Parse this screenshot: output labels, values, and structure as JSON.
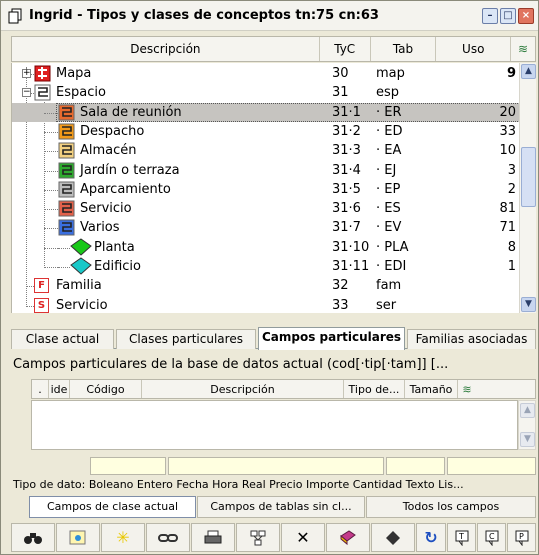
{
  "window": {
    "title": "Ingrid - Tipos y clases de conceptos tn:75 cn:63",
    "min": "–",
    "max": "□",
    "close": "×"
  },
  "columns": {
    "descripcion": "Descripción",
    "tyc": "TyC",
    "tab": "Tab",
    "uso": "Uso",
    "settings_icon": "≋"
  },
  "tree": [
    {
      "label": "Mapa",
      "tyc": "30",
      "tab": "map",
      "uso": "9",
      "icon": "map-icon",
      "color": "#e02020"
    },
    {
      "label": "Espacio",
      "tyc": "31",
      "tab": "esp",
      "uso": "",
      "icon": "space-icon",
      "color": "#ffffff"
    },
    {
      "label": "Sala de reunión",
      "tyc": "31·1",
      "tab": "· ER",
      "uso": "20",
      "icon": "space-icon",
      "color": "#e86a2e"
    },
    {
      "label": "Despacho",
      "tyc": "31·2",
      "tab": "· ED",
      "uso": "33",
      "icon": "space-icon",
      "color": "#f29a1a"
    },
    {
      "label": "Almacén",
      "tyc": "31·3",
      "tab": "· EA",
      "uso": "10",
      "icon": "space-icon",
      "color": "#f2d080"
    },
    {
      "label": "Jardín o terraza",
      "tyc": "31·4",
      "tab": "· EJ",
      "uso": "3",
      "icon": "space-icon",
      "color": "#2eaa2e"
    },
    {
      "label": "Aparcamiento",
      "tyc": "31·5",
      "tab": "· EP",
      "uso": "2",
      "icon": "space-icon",
      "color": "#bdbdbd"
    },
    {
      "label": "Servicio",
      "tyc": "31·6",
      "tab": "· ES",
      "uso": "81",
      "icon": "space-icon",
      "color": "#e2614a"
    },
    {
      "label": "Varios",
      "tyc": "31·7",
      "tab": "· EV",
      "uso": "71",
      "icon": "space-icon",
      "color": "#3a6fe0"
    },
    {
      "label": "Planta",
      "tyc": "31·10",
      "tab": "· PLA",
      "uso": "8",
      "icon": "floor-icon",
      "color": "#18c818"
    },
    {
      "label": "Edificio",
      "tyc": "31·11",
      "tab": "· EDI",
      "uso": "1",
      "icon": "building-icon",
      "color": "#18c8c8"
    },
    {
      "label": "Familia",
      "tyc": "32",
      "tab": "fam",
      "uso": "",
      "icon": "family-icon",
      "color": "#e02020",
      "letter": "F"
    },
    {
      "label": "Servicio",
      "tyc": "33",
      "tab": "ser",
      "uso": "",
      "icon": "service-icon",
      "color": "#e02020",
      "letter": "S"
    }
  ],
  "tabs": [
    "Clase actual",
    "Clases particulares",
    "Campos particulares",
    "Familias asociadas"
  ],
  "panel_title": "Campos particulares de la base de datos actual (cod[·tip[·tam]] [...",
  "grid": {
    "dot": ".",
    "ide": "ide",
    "codigo": "Código",
    "descripcion": "Descripción",
    "tipo": "Tipo de...",
    "tamano": "Tamaño"
  },
  "help_text": "Tipo de dato: Boleano Entero Fecha Hora Real Precio Importe Cantidad Texto Lis...",
  "filters": [
    "Campos de clase actual",
    "Campos de tablas sin cl...",
    "Todos los campos"
  ],
  "toolbar": [
    "binoculars-icon",
    "picture-icon",
    "new-icon",
    "link-icon",
    "print-icon",
    "tree-icon",
    "delete-icon",
    "book-icon",
    "diamond-icon",
    "refresh-icon",
    "note-icon",
    "note-left-icon",
    "note-p-icon"
  ]
}
